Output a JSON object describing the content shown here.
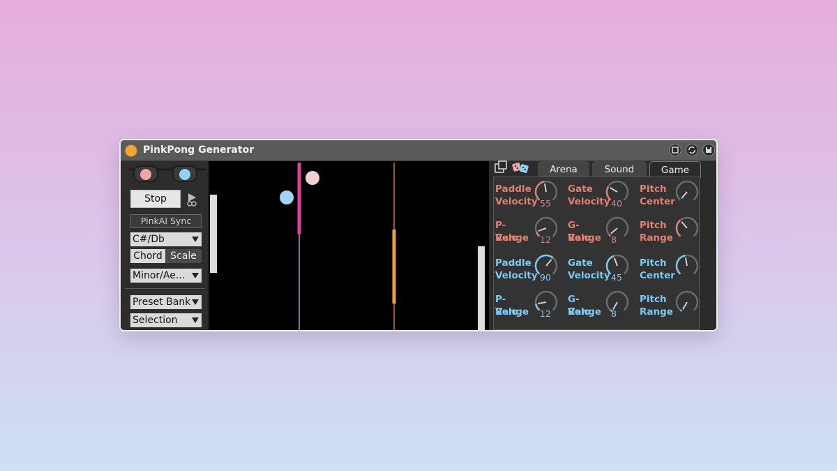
{
  "app": {
    "title": "PinkPong Generator",
    "title_buttons": [
      "hotswap-icon",
      "refresh-icon",
      "save-icon"
    ]
  },
  "left": {
    "stop_label": "Stop",
    "sync_label": "PinkAI Sync",
    "key_value": "C#/Db",
    "seg_chord": "Chord",
    "seg_scale": "Scale",
    "mode_value": "Minor/Ae...",
    "preset_label": "Preset Bank",
    "selection_label": "Selection"
  },
  "tabs": [
    "Arena",
    "Sound",
    "Game"
  ],
  "active_tab": "Game",
  "params": {
    "pink": [
      {
        "line1": "Paddle",
        "line2": "Velocity",
        "value": "55"
      },
      {
        "line1": "Gate",
        "line2": "Velocity",
        "value": "40"
      },
      {
        "line1": "Pitch",
        "line2": "Center",
        "value": ""
      },
      {
        "line1": "P-Velo",
        "line2": "Range",
        "value": "12"
      },
      {
        "line1": "G-Velo",
        "line2": "Range",
        "value": "8"
      },
      {
        "line1": "Pitch",
        "line2": "Range",
        "value": ""
      }
    ],
    "blue": [
      {
        "line1": "Paddle",
        "line2": "Velocity",
        "value": "90"
      },
      {
        "line1": "Gate",
        "line2": "Velocity",
        "value": "45"
      },
      {
        "line1": "Pitch",
        "line2": "Center",
        "value": ""
      },
      {
        "line1": "P-Velo",
        "line2": "Range",
        "value": "12"
      },
      {
        "line1": "G-Velo",
        "line2": "Range",
        "value": "8"
      },
      {
        "line1": "Pitch",
        "line2": "Range",
        "value": ""
      }
    ]
  },
  "colors": {
    "pink_text": "#e07f72",
    "blue_text": "#7ec8f2",
    "pink_lens": "#f2a5a8",
    "blue_lens": "#8fd2f7",
    "paddle_pink": "#e23ea0",
    "gate_orange": "#f0a23a",
    "ball_pink": "#f3d0d0",
    "ball_blue": "#9fd5f5"
  }
}
